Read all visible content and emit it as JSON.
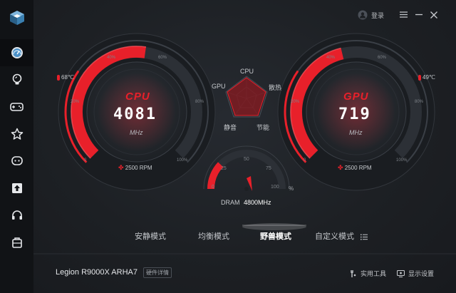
{
  "header": {
    "login_label": "登录",
    "menu_icon": "hamburger-menu-icon",
    "minimize_icon": "minimize-icon",
    "close_icon": "close-icon"
  },
  "sidebar": {
    "items": [
      {
        "name": "performance",
        "icon": "speedometer-icon",
        "active": true
      },
      {
        "name": "lighting",
        "icon": "lightbulb-icon",
        "active": false
      },
      {
        "name": "game",
        "icon": "gamepad-icon",
        "active": false
      },
      {
        "name": "favorites",
        "icon": "star-icon",
        "active": false
      },
      {
        "name": "chat",
        "icon": "chat-icon",
        "active": false
      },
      {
        "name": "upload",
        "icon": "upload-icon",
        "active": false
      },
      {
        "name": "headset",
        "icon": "headset-icon",
        "active": false
      },
      {
        "name": "toolbox",
        "icon": "toolbox-icon",
        "active": false
      }
    ]
  },
  "cpu": {
    "title": "CPU",
    "value": "4081",
    "unit": "MHz",
    "temp": "68℃",
    "fan": "2500 RPM",
    "ticks": {
      "t0": "0",
      "t20": "20%",
      "t40": "40%",
      "t60": "60%",
      "t80": "80%",
      "t100": "100%"
    },
    "load_fraction": 0.53
  },
  "gpu": {
    "title": "GPU",
    "value": "719",
    "unit": "MHz",
    "temp": "49℃",
    "fan": "2500 RPM",
    "ticks": {
      "t0": "0",
      "t20": "20%",
      "t40": "40%",
      "t60": "60%",
      "t80": "80%",
      "t100": "100%"
    },
    "load_fraction": 0.45
  },
  "radar": {
    "labels": {
      "top": "CPU",
      "left": "GPU",
      "right": "散热",
      "bottom_left": "静音",
      "bottom_right": "节能"
    }
  },
  "dram": {
    "label": "DRAM",
    "value": "4800MHz",
    "ticks": [
      "0",
      "25",
      "50",
      "75",
      "100"
    ],
    "unit": "%",
    "level": 0.24
  },
  "modes": {
    "items": [
      "安静模式",
      "均衡模式",
      "野兽模式",
      "自定义模式"
    ],
    "active_index": 2
  },
  "footer": {
    "device_name": "Legion R9000X ARHA7",
    "details_button": "硬件详情",
    "tools_label": "实用工具",
    "display_label": "显示设置"
  },
  "colors": {
    "accent": "#e8202a",
    "background": "#1d2024",
    "sidebar": "#111316"
  }
}
